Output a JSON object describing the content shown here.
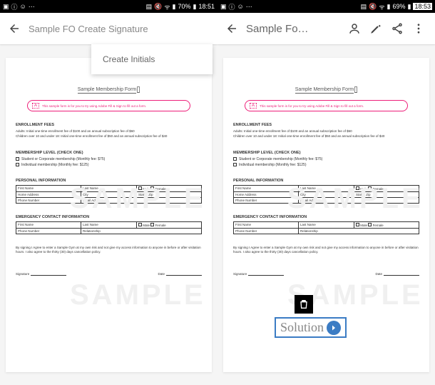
{
  "status": {
    "left_icons": [
      "image-icon",
      "info-icon",
      "smile-icon",
      "more-icon"
    ],
    "right_icons": [
      "sim-icon",
      "mute-icon",
      "wifi-icon",
      "signal-icon"
    ],
    "battery1": "70%",
    "time1": "18:51",
    "battery2": "69%",
    "time2": "18:53"
  },
  "left": {
    "title": "Sample FO  Create Signature",
    "dropdown_item": "Create Initials"
  },
  "right": {
    "title": "Sample Fo…"
  },
  "doc": {
    "title": "Sample Membership Form",
    "note": "This sample form is for you to try using Adobe Fill & Sign to fill out a form.",
    "enroll_title": "ENROLLMENT FEES",
    "enroll1": "Adults: Initial one-time enrollment fee of $100 and an annual subscription fee of $60",
    "enroll2": "Children over 10 and under 18: Initial one-time enrollment fee of $50 and an annual subscription fee of $40",
    "level_title": "MEMBERSHIP LEVEL (CHECK ONE)",
    "level1": "Student or Corporate membership (Monthly fee: $75)",
    "level2": "Individual membership (Monthly fee: $125)",
    "personal_title": "PERSONAL INFORMATION",
    "first_name": "First Name",
    "last_name": "Last Name",
    "male": "Male",
    "female": "Female",
    "home_addr": "Home Address",
    "city": "City",
    "state": "State",
    "zip": "Zip",
    "phone": "Phone Number",
    "email": "Email Address",
    "emerg_title": "EMERGENCY CONTACT INFORMATION",
    "relationship": "Relationship",
    "policy": "By signing I Agree to enter a Sample Gym at my own risk and not give my access information to anyone in before or after visitation hours. I also agree to the thirty (30) days cancellation policy.",
    "signature": "Signature",
    "date": "Date",
    "watermark": "SAMPLE"
  },
  "overlay": {
    "solution": "Solution"
  }
}
